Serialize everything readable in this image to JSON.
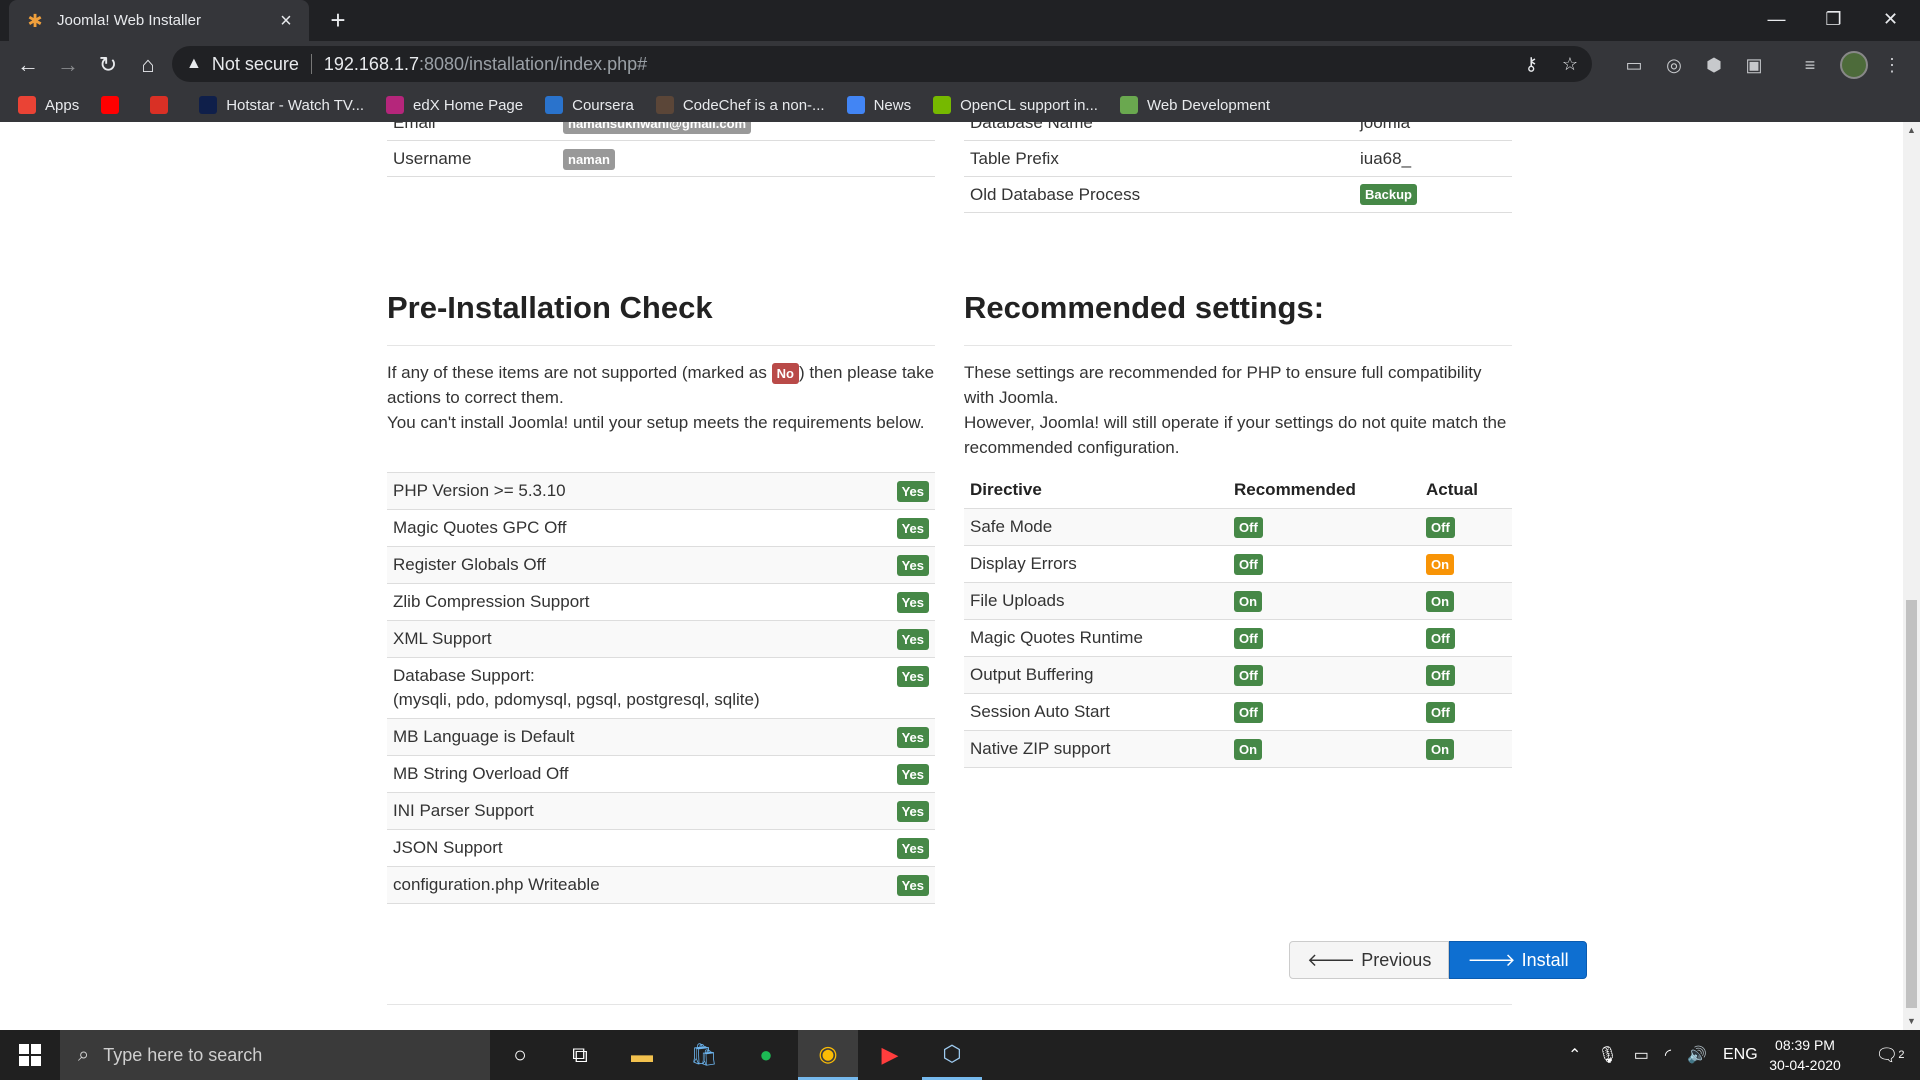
{
  "browser": {
    "tab_title": "Joomla! Web Installer",
    "address": {
      "security": "Not secure",
      "host": "192.168.1.7",
      "path": ":8080/installation/index.php#"
    }
  },
  "bookmarks": [
    {
      "label": "Apps",
      "icon": "apps-grid-icon",
      "color": "#ea4335"
    },
    {
      "label": "",
      "icon": "youtube-icon",
      "color": "#ff0000"
    },
    {
      "label": "",
      "icon": "gmail-icon",
      "color": "#d93025"
    },
    {
      "label": "Hotstar - Watch TV...",
      "icon": "hotstar-icon",
      "color": "#0f1f4a"
    },
    {
      "label": "edX Home Page",
      "icon": "edx-icon",
      "color": "#b5267b"
    },
    {
      "label": "Coursera",
      "icon": "coursera-icon",
      "color": "#2a73cc"
    },
    {
      "label": "CodeChef is a non-...",
      "icon": "codechef-icon",
      "color": "#5b4638"
    },
    {
      "label": "News",
      "icon": "google-news-icon",
      "color": "#4285f4"
    },
    {
      "label": "OpenCL support in...",
      "icon": "nvidia-icon",
      "color": "#76b900"
    },
    {
      "label": "Web Development",
      "icon": "folder-icon",
      "color": "#6aa84f"
    }
  ],
  "admin_info": {
    "rows": [
      {
        "label": "Email",
        "value": "namansukhwani@gmail.com"
      },
      {
        "label": "Username",
        "value": "naman"
      }
    ]
  },
  "db_info": {
    "rows": [
      {
        "label": "Database Name",
        "value": "joomla"
      },
      {
        "label": "Table Prefix",
        "value": "iua68_"
      },
      {
        "label": "Old Database Process",
        "value": "Backup"
      }
    ]
  },
  "precheck": {
    "title": "Pre-Installation Check",
    "intro_before": "If any of these items are not supported (marked as ",
    "no_label": "No",
    "intro_after": ") then please take actions to correct them.",
    "intro_2": "You can't install Joomla! until your setup meets the requirements below.",
    "items": [
      {
        "label": "PHP Version >= 5.3.10",
        "status": "Yes"
      },
      {
        "label": "Magic Quotes GPC Off",
        "status": "Yes"
      },
      {
        "label": "Register Globals Off",
        "status": "Yes"
      },
      {
        "label": "Zlib Compression Support",
        "status": "Yes"
      },
      {
        "label": "XML Support",
        "status": "Yes"
      },
      {
        "label": "Database Support:",
        "label2": "(mysqli, pdo, pdomysql, pgsql, postgresql, sqlite)",
        "status": "Yes"
      },
      {
        "label": "MB Language is Default",
        "status": "Yes"
      },
      {
        "label": "MB String Overload Off",
        "status": "Yes"
      },
      {
        "label": "INI Parser Support",
        "status": "Yes"
      },
      {
        "label": "JSON Support",
        "status": "Yes"
      },
      {
        "label": "configuration.php Writeable",
        "status": "Yes"
      }
    ]
  },
  "recommended": {
    "title": "Recommended settings:",
    "intro_1": "These settings are recommended for PHP to ensure full compatibility with Joomla.",
    "intro_2": "However, Joomla! will still operate if your settings do not quite match the recommended configuration.",
    "headers": {
      "directive": "Directive",
      "recommended": "Recommended",
      "actual": "Actual"
    },
    "rows": [
      {
        "directive": "Safe Mode",
        "recommended": "Off",
        "actual": "Off",
        "match": true
      },
      {
        "directive": "Display Errors",
        "recommended": "Off",
        "actual": "On",
        "match": false
      },
      {
        "directive": "File Uploads",
        "recommended": "On",
        "actual": "On",
        "match": true
      },
      {
        "directive": "Magic Quotes Runtime",
        "recommended": "Off",
        "actual": "Off",
        "match": true
      },
      {
        "directive": "Output Buffering",
        "recommended": "Off",
        "actual": "Off",
        "match": true
      },
      {
        "directive": "Session Auto Start",
        "recommended": "Off",
        "actual": "Off",
        "match": true
      },
      {
        "directive": "Native ZIP support",
        "recommended": "On",
        "actual": "On",
        "match": true
      }
    ]
  },
  "buttons": {
    "previous": "Previous",
    "install": "Install"
  },
  "colors": {
    "success": "#468847",
    "important": "#b94a48",
    "warning": "#f89406",
    "primary": "#0e6fd1"
  },
  "taskbar": {
    "search_placeholder": "Type here to search",
    "lang": "ENG",
    "time": "08:39 PM",
    "date": "30-04-2020",
    "notifications": "2"
  }
}
